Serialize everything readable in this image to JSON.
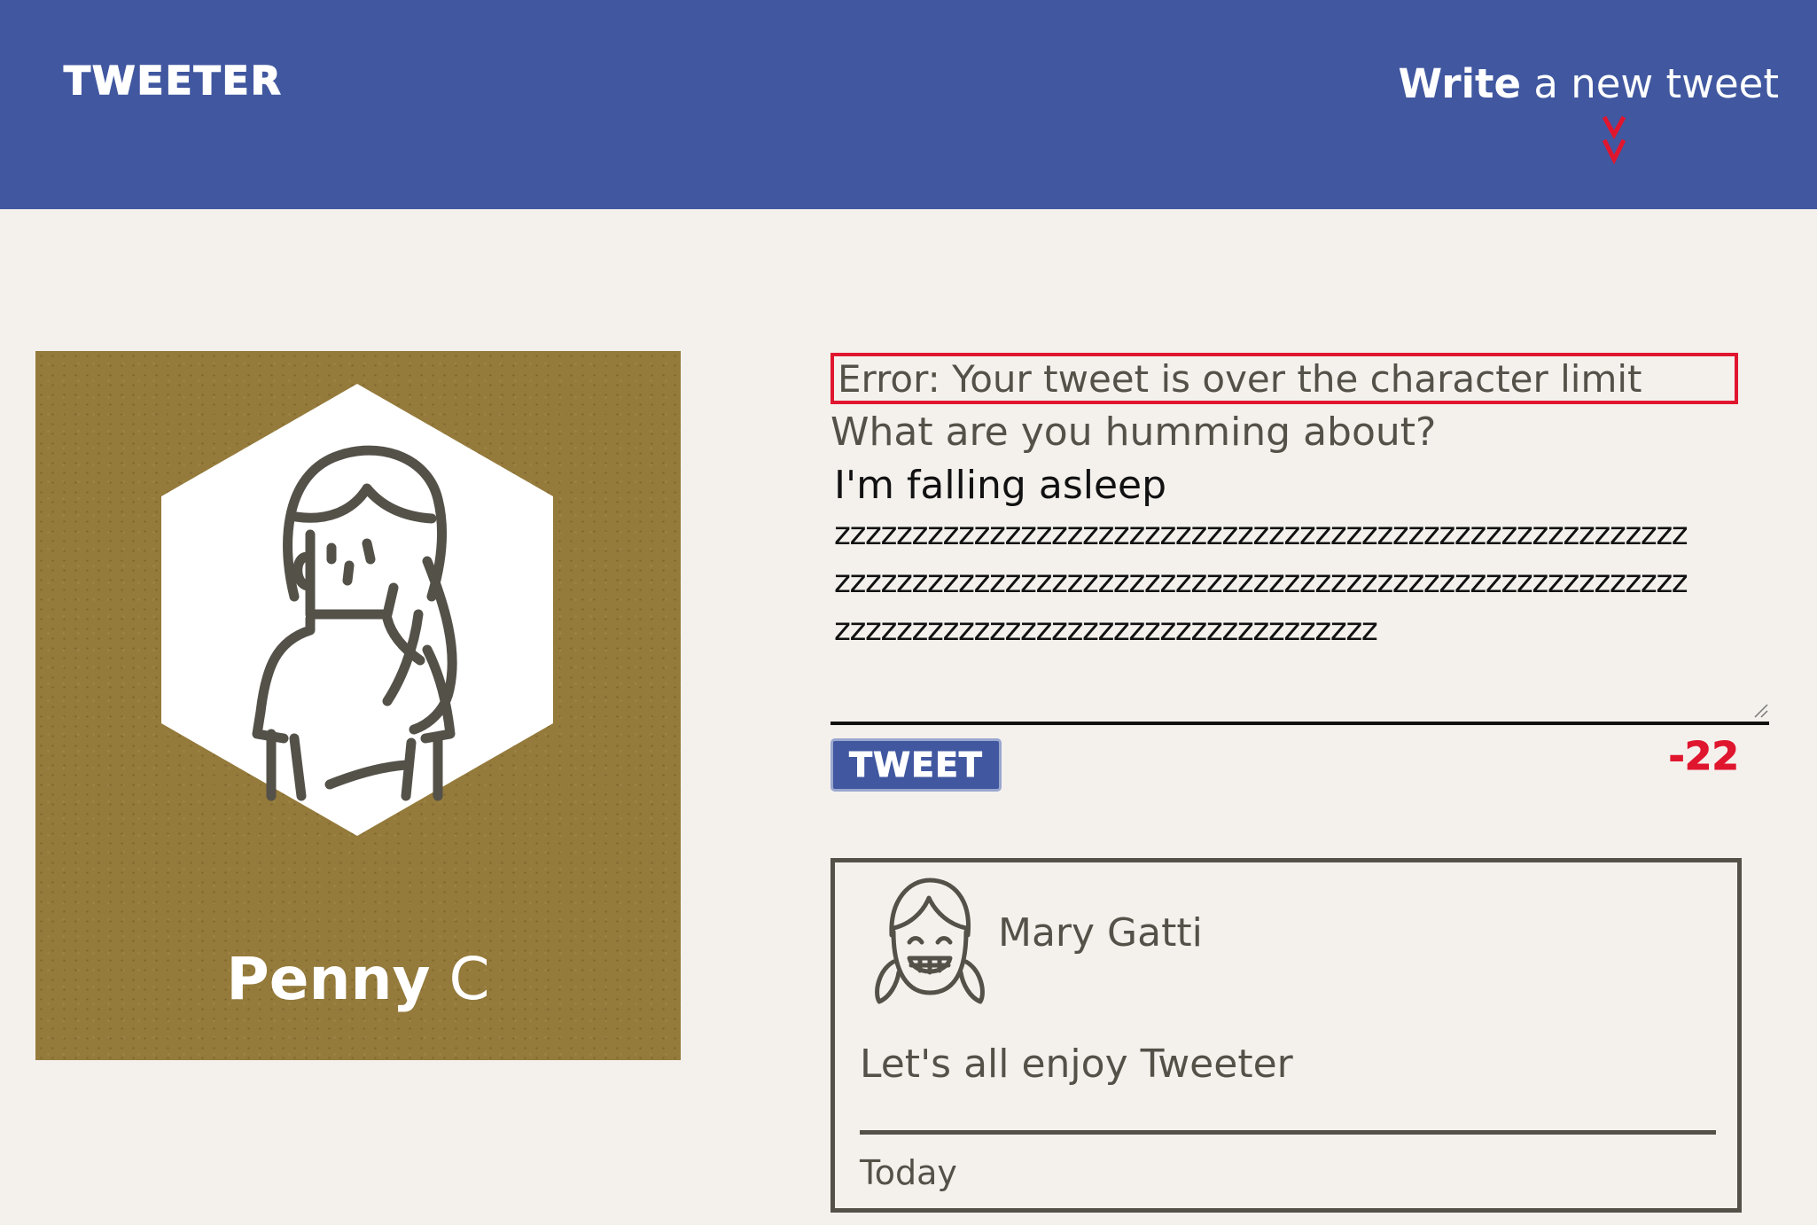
{
  "nav": {
    "logo": "TWEETER",
    "compose_bold": "Write",
    "compose_rest": " a new tweet",
    "compose_icon": "double-chevron-down-icon"
  },
  "profile": {
    "first_name": "Penny",
    "last_name": " C",
    "avatar_icon": "woman-avatar-icon"
  },
  "composer": {
    "error": "Error: Your tweet is over the character limit",
    "label": "What are you humming about?",
    "text_line1": "I'm falling asleep",
    "text_line2": "zzzzzzzzzzzzzzzzzzzzzzzzzzzzzzzzzzzzzzzzzzzzzzzzzzzzzzz",
    "text_line3": "zzzzzzzzzzzzzzzzzzzzzzzzzzzzzzzzzzzzzzzzzzzzzzzzzzzzzzz",
    "text_line4": "zzzzzzzzzzzzzzzzzzzzzzzzzzzzzzzzzzz",
    "button_label": "TWEET",
    "counter": "-22"
  },
  "tweets": [
    {
      "author": "Mary Gatti",
      "avatar_icon": "girl-pigtails-avatar-icon",
      "content": "Let's all enjoy Tweeter",
      "time": "Today"
    }
  ],
  "colors": {
    "nav_bg": "#4158a0",
    "page_bg": "#f4f1ed",
    "profile_bg": "#947a3b",
    "error": "#e0162f",
    "text": "#545149"
  }
}
